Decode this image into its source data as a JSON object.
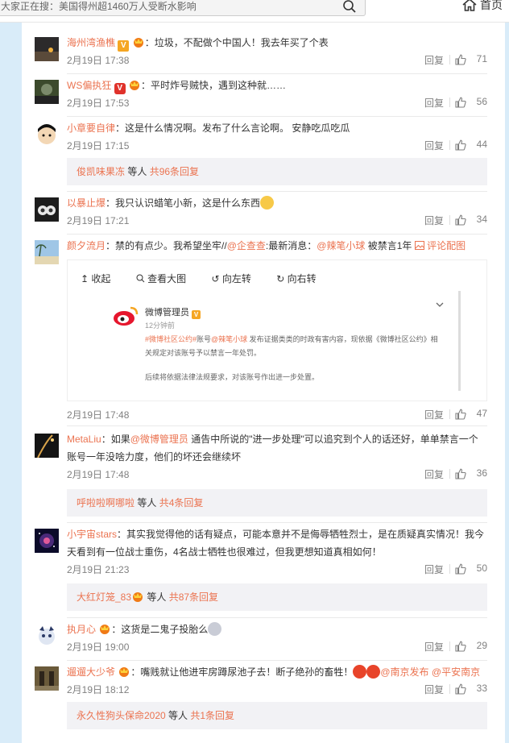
{
  "search": {
    "text": "大家正在搜：美国得州超1460万人受断水影响"
  },
  "nav": {
    "home_label": "首页"
  },
  "comments": [
    {
      "user": "海州湾渔樵",
      "text": "：垃圾，不配做个中国人！我去年买了个表",
      "time": "2月19日 17:38",
      "reply": "回复",
      "likes": "71"
    },
    {
      "user": "WS偏执狂",
      "text": "：平时炸号贼快，遇到这种就……",
      "time": "2月19日 17:53",
      "reply": "回复",
      "likes": "56"
    },
    {
      "user": "小章要自律",
      "text": "：这是什么情况啊。发布了什么言论啊。 安静吃瓜吃瓜",
      "time": "2月19日 17:15",
      "reply": "回复",
      "likes": "44",
      "more": {
        "user": "俊凯味果冻",
        "mid": " 等人 ",
        "count": "共96条回复"
      }
    },
    {
      "user": "以暴止爆",
      "text": "：我只认识蜡笔小新，这是什么东西",
      "time": "2月19日 17:21",
      "reply": "回复",
      "likes": "34"
    },
    {
      "user": "颜夕流月",
      "text_a": "：禁的有点少。我希望坐牢//",
      "mention1": "@企查查",
      "text_b": ":最新消息：",
      "mention2": "@辣笔小球",
      "text_c": " 被禁言1年 ",
      "comment_pic": "评论配图",
      "time": "2月19日 17:48",
      "reply": "回复",
      "likes": "47",
      "media": {
        "toolbar": [
          "收起",
          "查看大图",
          "向左转",
          "向右转"
        ],
        "name": "微博管理员",
        "posted": "12分钟前",
        "text_a": "#微博社区公约#",
        "text_b": "账号",
        "text_c": "@辣笔小球",
        "text_d": " 发布证据类类的时政有害内容，现依据《微博社区公约》相关规定对该账号予以禁言一年处罚。",
        "text_e": "后续将依据法律法规要求，对该账号作出进一步处置。"
      }
    },
    {
      "user": "MetaLiu",
      "text_a": "：如果",
      "mention": "@微博管理员",
      "text_b": " 通告中所说的\"进一步处理\"可以追究到个人的话还好，单单禁言一个账号一年没啥力度，他们的坏还会继续坏",
      "time": "2月19日 17:48",
      "reply": "回复",
      "likes": "36",
      "more": {
        "user": "呼啦啦啊哪啦",
        "mid": " 等人 ",
        "count": "共4条回复"
      }
    },
    {
      "user": "小宇宙stars",
      "text": "：其实我觉得他的话有疑点，可能本意并不是侮辱牺牲烈士，是在质疑真实情况！我今天看到有一位战士重伤，4名战士牺牲也很难过，但我更想知道真相如何！",
      "time": "2月19日 21:23",
      "reply": "回复",
      "likes": "50",
      "more": {
        "user": "大红灯笼_83",
        "mid": " 等人 ",
        "count": "共87条回复"
      }
    },
    {
      "user": "执月心",
      "text": "：这货是二鬼子投胎么",
      "time": "2月19日 19:00",
      "reply": "回复",
      "likes": "29"
    },
    {
      "user": "遛遛大少爷",
      "text_a": "：嘴贱就让他进牢房蹲尿池子去！断子绝孙的畜牲！",
      "mention1": "@南京发布",
      "mention2": "@平安南京",
      "time": "2月19日 18:12",
      "reply": "回复",
      "likes": "33",
      "more": {
        "user": "永久性狗头保命2020",
        "mid": " 等人 ",
        "count": "共1条回复"
      }
    }
  ],
  "colors": {
    "accent": "#eb7350",
    "page_bg": "#d9ecf9",
    "meta": "#808080"
  }
}
